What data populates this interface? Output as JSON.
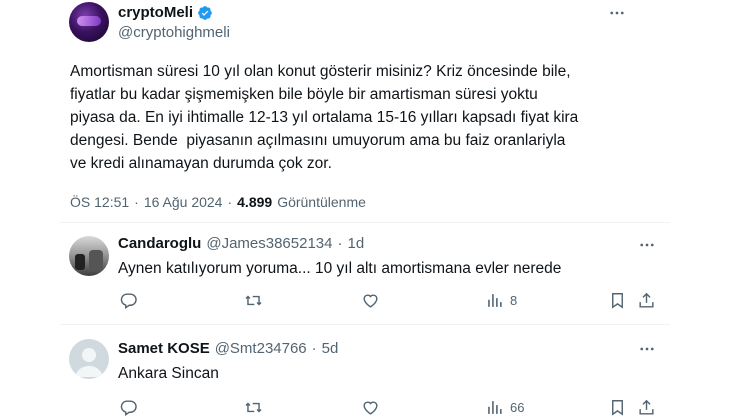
{
  "main_tweet": {
    "display_name": "cryptoMeli",
    "handle": "@cryptohighmeli",
    "text": "Amortisman süresi 10 yıl olan konut gösterir misiniz? Kriz öncesinde bile,\nfiyatlar bu kadar şişmemişken bile böyle bir amartisman süresi yoktu\npiyasa da. En iyi ihtimalle 12-13 yıl ortalama 15-16 yılları kapsadı fiyat kira\ndengesi. Bende  piyasanın açılmasını umuyorum ama bu faiz oranlariyla\nve kredi alınamayan durumda çok zor.",
    "time": "ÖS 12:51",
    "sep": "·",
    "date": "16 Ağu 2024",
    "views_count": "4.899",
    "views_label": "Görüntülenme"
  },
  "replies": [
    {
      "name": "Candaroglu",
      "handle": "@James38652134",
      "dot": "·",
      "time": "1d",
      "text": "Aynen katılıyorum yoruma... 10 yıl altı amortismana evler nerede",
      "views": "8"
    },
    {
      "name": "Samet KOSE",
      "handle": "@Smt234766",
      "dot": "·",
      "time": "5d",
      "text": "Ankara Sincan",
      "views": "66"
    }
  ],
  "colors": {
    "text": "#0f1419",
    "secondary": "#536471",
    "verified": "#1d9bf0",
    "divider": "#eff3f4"
  },
  "icons": {
    "more": "more-horizontal-icon",
    "verified": "verified-badge-icon",
    "reply": "reply-icon",
    "repost": "repost-icon",
    "like": "heart-icon",
    "views": "views-chart-icon",
    "bookmark": "bookmark-icon",
    "share": "share-icon"
  }
}
